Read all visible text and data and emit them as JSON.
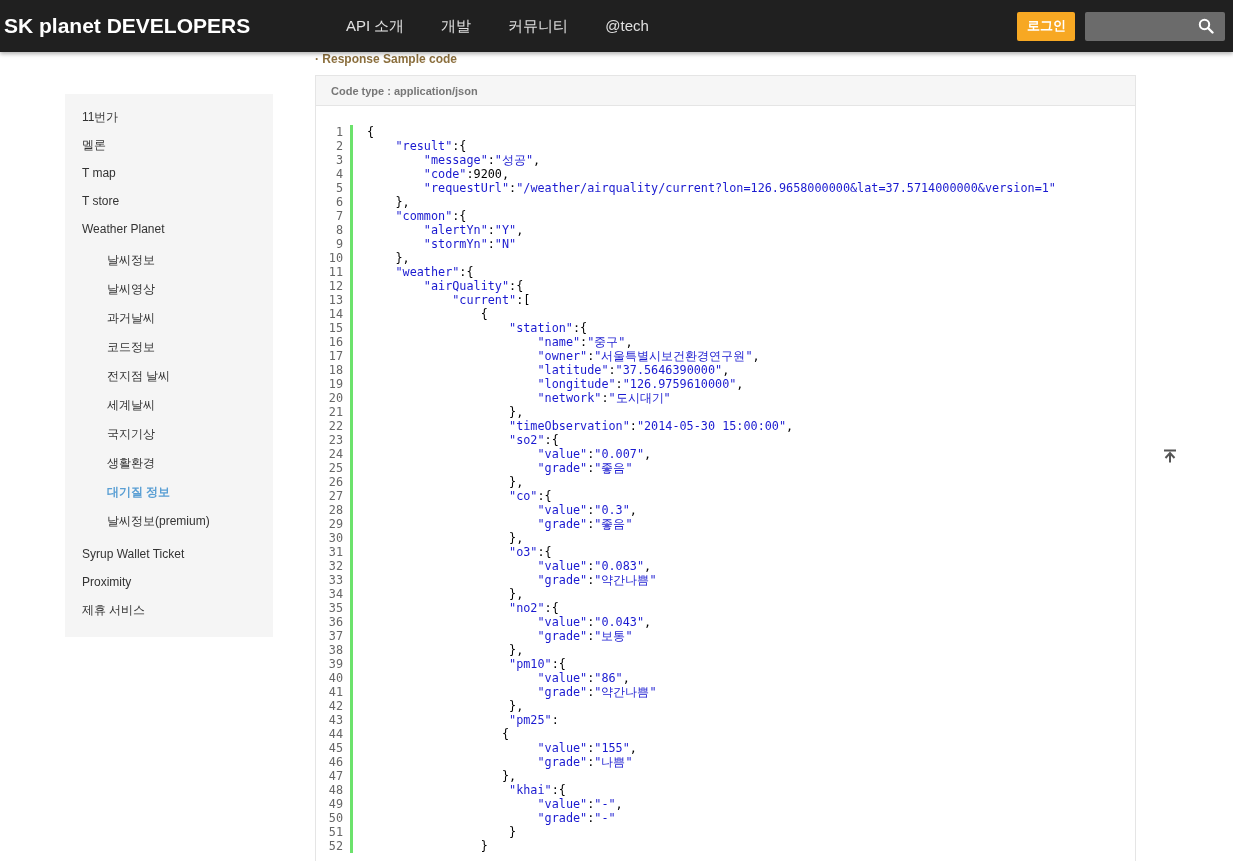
{
  "header": {
    "logo": "SK planet DEVELOPERS",
    "nav": [
      {
        "label": "API 소개"
      },
      {
        "label": "개발"
      },
      {
        "label": "커뮤니티"
      },
      {
        "label": "@tech"
      }
    ],
    "login_button": "로그인"
  },
  "section_heading": "· Response Sample code",
  "sidebar": {
    "items": [
      {
        "label": "11번가",
        "selected": false
      },
      {
        "label": "멜론",
        "selected": false
      },
      {
        "label": "T map",
        "selected": false
      },
      {
        "label": "T store",
        "selected": false
      },
      {
        "label": "Weather Planet",
        "selected": false,
        "children": [
          {
            "label": "날씨정보",
            "selected": false
          },
          {
            "label": "날씨영상",
            "selected": false
          },
          {
            "label": "과거날씨",
            "selected": false
          },
          {
            "label": "코드정보",
            "selected": false
          },
          {
            "label": "전지점 날씨",
            "selected": false
          },
          {
            "label": "세계날씨",
            "selected": false
          },
          {
            "label": "국지기상",
            "selected": false
          },
          {
            "label": "생활환경",
            "selected": false
          },
          {
            "label": "대기질 정보",
            "selected": true
          },
          {
            "label": "날씨정보(premium)",
            "selected": false
          }
        ]
      },
      {
        "label": "Syrup Wallet Ticket",
        "selected": false
      },
      {
        "label": "Proximity",
        "selected": false
      },
      {
        "label": "제휴 서비스",
        "selected": false
      }
    ]
  },
  "code_panel": {
    "code_type": "Code type : application/json",
    "lines": [
      {
        "number": "1",
        "text": "{"
      },
      {
        "number": "2",
        "text": "    \"result\":{"
      },
      {
        "number": "3",
        "text": "        \"message\":\"성공\","
      },
      {
        "number": "4",
        "text": "        \"code\":9200,"
      },
      {
        "number": "5",
        "text": "        \"requestUrl\":\"/weather/airquality/current?lon=126.9658000000&lat=37.5714000000&version=1\""
      },
      {
        "number": "6",
        "text": "    },"
      },
      {
        "number": "7",
        "text": "    \"common\":{"
      },
      {
        "number": "8",
        "text": "        \"alertYn\":\"Y\","
      },
      {
        "number": "9",
        "text": "        \"stormYn\":\"N\""
      },
      {
        "number": "10",
        "text": "    },"
      },
      {
        "number": "11",
        "text": "    \"weather\":{"
      },
      {
        "number": "12",
        "text": "        \"airQuality\":{"
      },
      {
        "number": "13",
        "text": "            \"current\":["
      },
      {
        "number": "14",
        "text": "                {"
      },
      {
        "number": "15",
        "text": "                    \"station\":{"
      },
      {
        "number": "16",
        "text": "                        \"name\":\"중구\","
      },
      {
        "number": "17",
        "text": "                        \"owner\":\"서울특별시보건환경연구원\","
      },
      {
        "number": "18",
        "text": "                        \"latitude\":\"37.5646390000\","
      },
      {
        "number": "19",
        "text": "                        \"longitude\":\"126.9759610000\","
      },
      {
        "number": "20",
        "text": "                        \"network\":\"도시대기\""
      },
      {
        "number": "21",
        "text": "                    },"
      },
      {
        "number": "22",
        "text": "                    \"timeObservation\":\"2014-05-30 15:00:00\","
      },
      {
        "number": "23",
        "text": "                    \"so2\":{"
      },
      {
        "number": "24",
        "text": "                        \"value\":\"0.007\","
      },
      {
        "number": "25",
        "text": "                        \"grade\":\"좋음\""
      },
      {
        "number": "26",
        "text": "                    },"
      },
      {
        "number": "27",
        "text": "                    \"co\":{"
      },
      {
        "number": "28",
        "text": "                        \"value\":\"0.3\","
      },
      {
        "number": "29",
        "text": "                        \"grade\":\"좋음\""
      },
      {
        "number": "30",
        "text": "                    },"
      },
      {
        "number": "31",
        "text": "                    \"o3\":{"
      },
      {
        "number": "32",
        "text": "                        \"value\":\"0.083\","
      },
      {
        "number": "33",
        "text": "                        \"grade\":\"약간나쁨\""
      },
      {
        "number": "34",
        "text": "                    },"
      },
      {
        "number": "35",
        "text": "                    \"no2\":{"
      },
      {
        "number": "36",
        "text": "                        \"value\":\"0.043\","
      },
      {
        "number": "37",
        "text": "                        \"grade\":\"보통\""
      },
      {
        "number": "38",
        "text": "                    },"
      },
      {
        "number": "39",
        "text": "                    \"pm10\":{"
      },
      {
        "number": "40",
        "text": "                        \"value\":\"86\","
      },
      {
        "number": "41",
        "text": "                        \"grade\":\"약간나쁨\""
      },
      {
        "number": "42",
        "text": "                    },"
      },
      {
        "number": "43",
        "text": "                    \"pm25\":"
      },
      {
        "number": "44",
        "text": "                   {"
      },
      {
        "number": "45",
        "text": "                        \"value\":\"155\","
      },
      {
        "number": "46",
        "text": "                        \"grade\":\"나쁨\""
      },
      {
        "number": "47",
        "text": "                   },"
      },
      {
        "number": "48",
        "text": "                    \"khai\":{"
      },
      {
        "number": "49",
        "text": "                        \"value\":\"-\","
      },
      {
        "number": "50",
        "text": "                        \"grade\":\"-\""
      },
      {
        "number": "51",
        "text": "                    }"
      },
      {
        "number": "52",
        "text": "                }"
      }
    ]
  }
}
